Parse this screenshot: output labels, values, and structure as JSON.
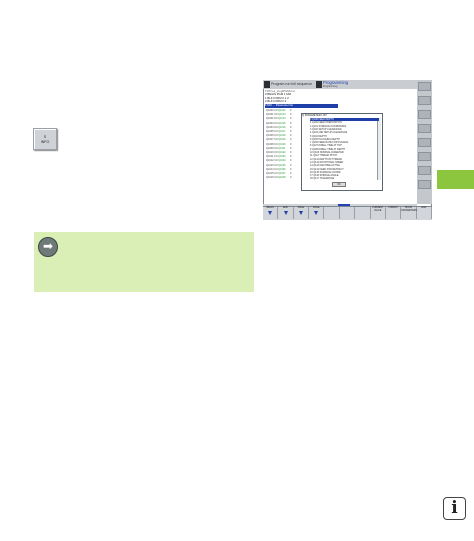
{
  "key": {
    "line1": "S",
    "line2": "INFO"
  },
  "note": {
    "icon": "arrow-right-icon"
  },
  "screen": {
    "header": {
      "mode1": "Program run full sequence",
      "mode2": "Programming",
      "sub": "Programming"
    },
    "path": "TNC:\\nc_prog\\PGM\\1.H",
    "program": [
      "0  BEGIN PGM 1 MM",
      "1  BLK FORM 0.1 Z",
      "2  BLK FORM 0.2",
      "3  ...."
    ],
    "selected_line": "FN16 ... Parameter list",
    "grid": [
      [
        "Q1000 0.0",
        "Q1012",
        "0"
      ],
      [
        "Q1001 0.0",
        "Q1013",
        "0"
      ],
      [
        "Q1002 0.0",
        "Q1014",
        "0"
      ],
      [
        "Q1003 0.0",
        "Q1015",
        "0"
      ],
      [
        "Q1004 0.0",
        "Q1016",
        "0"
      ],
      [
        "Q1005 0.0",
        "Q1017",
        "0"
      ],
      [
        "Q1006 0.0",
        "Q1018",
        "0"
      ],
      [
        "Q1007 0.0",
        "Q1019",
        "0"
      ],
      [
        "Q1008 0.0",
        "Q1020",
        "0"
      ],
      [
        "Q1009 0.0",
        "Q1021",
        "0"
      ],
      [
        "Q1010 0.0",
        "Q1022",
        "0"
      ],
      [
        "Q1011 0.0",
        "Q1023",
        "0"
      ],
      [
        "Q1012 0.0",
        "Q1024",
        "0"
      ],
      [
        "Q1013 0.0",
        "Q1025",
        "0"
      ],
      [
        "Q1014 0.0",
        "Q1026",
        "0"
      ],
      [
        "Q1015 0.0",
        "Q1027",
        "0"
      ],
      [
        "Q1016 0.0",
        "Q1028",
        "0"
      ]
    ],
    "popup": {
      "title": "Q PARAMETER LIST",
      "items": [
        "0  Q108   FEED DEPTH",
        "1  Q100   FEED PREPOSITION",
        "2  Q101   SURFACE COORDINATE",
        "3  Q102   SETUP CLEARANCE",
        "4  Q103   2ND SETUP CLEARANCE",
        "5  Q104   DEPTH",
        "6  Q105   PLUNGING DEPTH",
        "7  Q106   FEED RATE FOR PLNGNG",
        "8  Q107   DWELL TIME AT TOP",
        "9  Q108   DWELL TIME AT DEPTH",
        "10 Q109   NOMINAL DIAMETER",
        "11 Q110   THREAD PITCH",
        "12 Q111   DEPTH OF THREAD",
        "13 Q112   ROTATIONAL SPEED",
        "14 Q113   MACHINE ACTIVE",
        "15 Q114   FEED FOR RETRACT",
        "16 Q115   SURFACE COORD.",
        "17 Q116   SPINDLE ANGLE",
        "18 Q117   TOLERANCE"
      ],
      "ok": "OK"
    },
    "progress": 0.08,
    "softkeys": [
      {
        "label": "BEGIN",
        "arrow": true
      },
      {
        "label": "END",
        "arrow": true
      },
      {
        "label": "PAGE",
        "arrow": true
      },
      {
        "label": "PAGE",
        "arrow": true
      },
      {
        "label": "",
        "arrow": false
      },
      {
        "label": "",
        "arrow": false
      },
      {
        "label": "",
        "arrow": false
      },
      {
        "label": "CURRENT VALUE",
        "arrow": false
      },
      {
        "label": "FORMAT",
        "arrow": false
      },
      {
        "label": "SHOW PARAMETERS",
        "arrow": false
      },
      {
        "label": "END",
        "arrow": false
      }
    ]
  },
  "info_icon": "i"
}
